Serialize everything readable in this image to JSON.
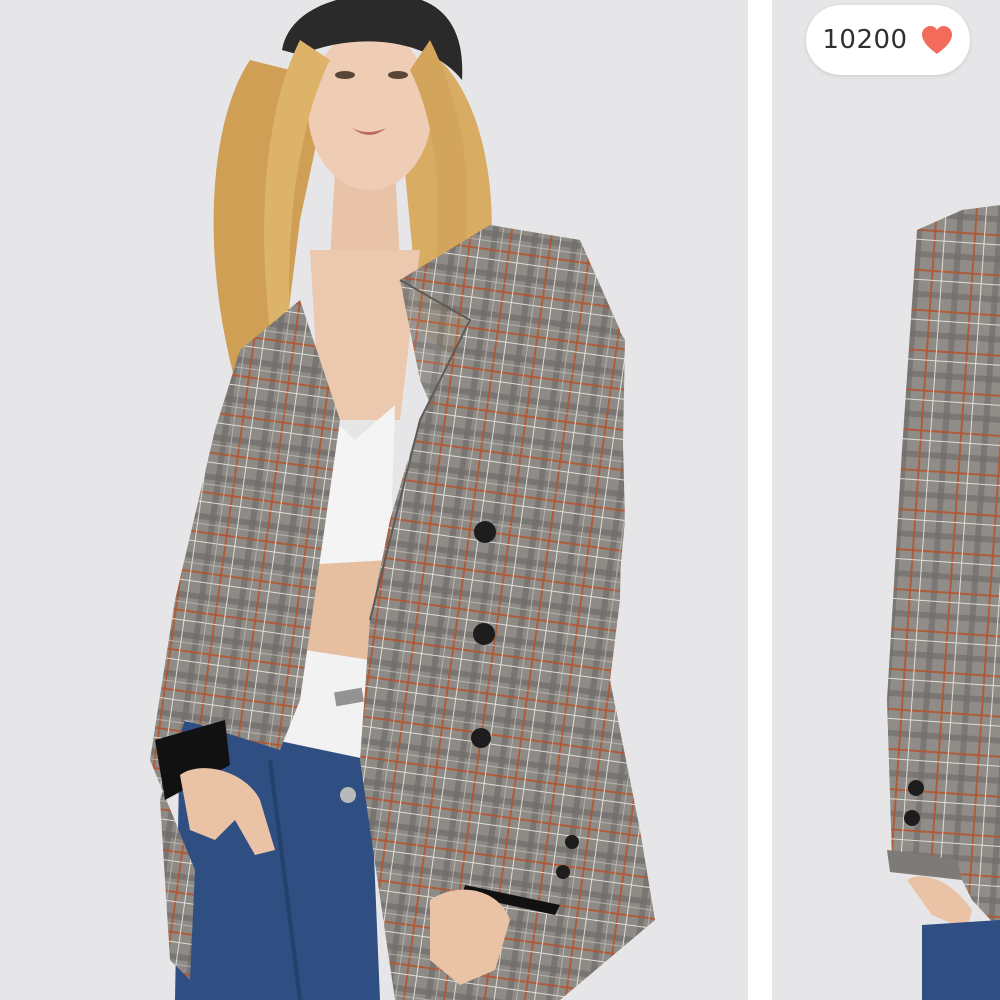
{
  "like_badge": {
    "count": "10200",
    "icon": "heart-icon",
    "icon_color": "#f26b5b"
  },
  "colors": {
    "background": "#e6e6e8",
    "blazer": "#8d8a86",
    "jeans": "#2f4f82",
    "hair": "#d8ad63",
    "cap": "#2a2a2a"
  }
}
